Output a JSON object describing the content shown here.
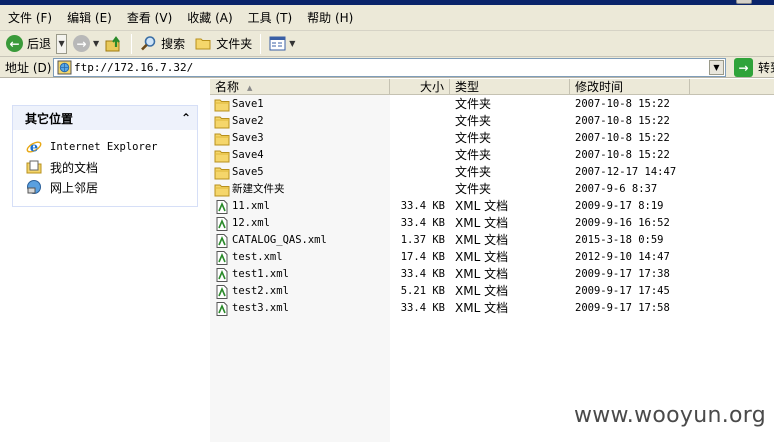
{
  "menu": [
    {
      "label": "文件 (F)"
    },
    {
      "label": "编辑 (E)"
    },
    {
      "label": "查看 (V)"
    },
    {
      "label": "收藏 (A)"
    },
    {
      "label": "工具 (T)"
    },
    {
      "label": "帮助 (H)"
    }
  ],
  "toolbar": {
    "back_label": "后退",
    "search_label": "搜索",
    "folders_label": "文件夹"
  },
  "address": {
    "label": "地址 (D)",
    "value": "ftp://172.16.7.32/",
    "go_label": "转到"
  },
  "other_places": {
    "title": "其它位置",
    "collapse_symbol": "⌃",
    "items": [
      {
        "label": "Internet Explorer",
        "icon": "internet-explorer-icon"
      },
      {
        "label": "我的文档",
        "icon": "my-documents-icon"
      },
      {
        "label": "网上邻居",
        "icon": "network-places-icon"
      }
    ]
  },
  "columns": {
    "name": "名称",
    "size": "大小",
    "type": "类型",
    "modified": "修改时间"
  },
  "files": [
    {
      "name": "Save1",
      "size": "",
      "type": "文件夹",
      "modified": "2007-10-8 15:22",
      "kind": "folder"
    },
    {
      "name": "Save2",
      "size": "",
      "type": "文件夹",
      "modified": "2007-10-8 15:22",
      "kind": "folder"
    },
    {
      "name": "Save3",
      "size": "",
      "type": "文件夹",
      "modified": "2007-10-8 15:22",
      "kind": "folder"
    },
    {
      "name": "Save4",
      "size": "",
      "type": "文件夹",
      "modified": "2007-10-8 15:22",
      "kind": "folder"
    },
    {
      "name": "Save5",
      "size": "",
      "type": "文件夹",
      "modified": "2007-12-17 14:47",
      "kind": "folder"
    },
    {
      "name": "新建文件夹",
      "size": "",
      "type": "文件夹",
      "modified": "2007-9-6 8:37",
      "kind": "folder"
    },
    {
      "name": "11.xml",
      "size": "33.4 KB",
      "type": "XML 文档",
      "modified": "2009-9-17 8:19",
      "kind": "xml"
    },
    {
      "name": "12.xml",
      "size": "33.4 KB",
      "type": "XML 文档",
      "modified": "2009-9-16 16:52",
      "kind": "xml"
    },
    {
      "name": "CATALOG_QAS.xml",
      "size": "1.37 KB",
      "type": "XML 文档",
      "modified": "2015-3-18 0:59",
      "kind": "xml"
    },
    {
      "name": "test.xml",
      "size": "17.4 KB",
      "type": "XML 文档",
      "modified": "2012-9-10 14:47",
      "kind": "xml"
    },
    {
      "name": "test1.xml",
      "size": "33.4 KB",
      "type": "XML 文档",
      "modified": "2009-9-17 17:38",
      "kind": "xml"
    },
    {
      "name": "test2.xml",
      "size": "5.21 KB",
      "type": "XML 文档",
      "modified": "2009-9-17 17:45",
      "kind": "xml"
    },
    {
      "name": "test3.xml",
      "size": "33.4 KB",
      "type": "XML 文档",
      "modified": "2009-9-17 17:58",
      "kind": "xml"
    }
  ],
  "watermark": "www.wooyun.org"
}
